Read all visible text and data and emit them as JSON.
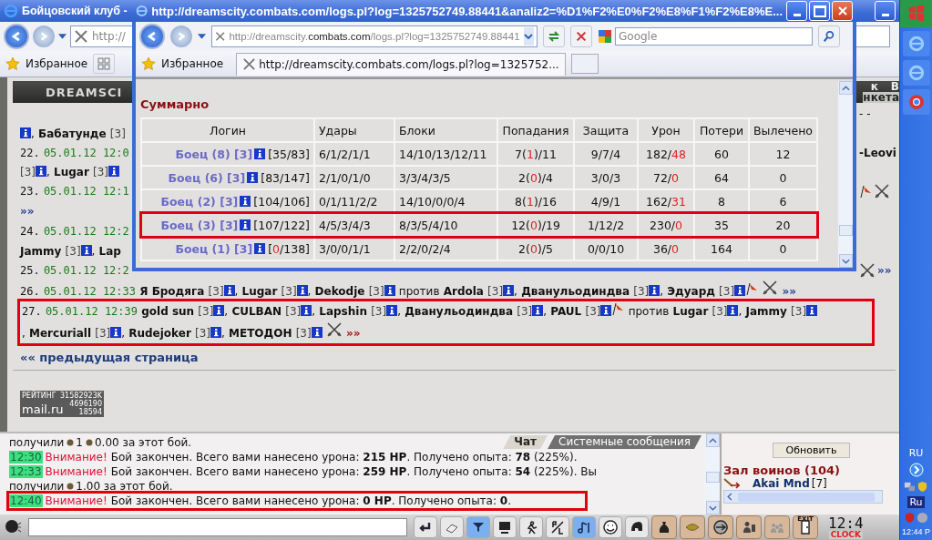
{
  "back_window": {
    "title": "Бойцовский клуб -",
    "address": "http://",
    "favorites": "Избранное",
    "logo": "DREAMSCI",
    "menu_top": [
      "к",
      "В"
    ],
    "menu_bottom": "нкета"
  },
  "log_lines": [
    {
      "right": [
        {
          "kind": "word",
          "text": "- -"
        }
      ]
    },
    {
      "left": [
        {
          "kind": "info"
        },
        {
          "kind": "sep",
          "text": ","
        },
        {
          "kind": "nick",
          "text": "Бабатунде"
        },
        {
          "kind": "lvl",
          "text": "[3]"
        }
      ]
    },
    {
      "left": [
        {
          "kind": "index",
          "text": "22."
        },
        {
          "kind": "time",
          "text": "05.01.12 12:0"
        }
      ],
      "right": [
        {
          "kind": "nick",
          "text": "-Leovi"
        }
      ]
    },
    {
      "left": [
        {
          "kind": "lvl",
          "text": "[3]"
        },
        {
          "kind": "info"
        },
        {
          "kind": "sep",
          "text": ","
        },
        {
          "kind": "nick",
          "text": "Lugar"
        },
        {
          "kind": "lvl",
          "text": "[3]"
        },
        {
          "kind": "info"
        }
      ]
    },
    {
      "left": [
        {
          "kind": "index",
          "text": "23."
        },
        {
          "kind": "time",
          "text": "05.01.12 12:1"
        }
      ],
      "right": [
        {
          "kind": "flag"
        },
        {
          "kind": "swords"
        }
      ]
    },
    {
      "left": [
        {
          "kind": "more",
          "text": "»»",
          "color": "#28449a"
        }
      ]
    },
    {
      "left": [
        {
          "kind": "index",
          "text": "24."
        },
        {
          "kind": "time",
          "text": "05.01.12 12:2"
        }
      ]
    },
    {
      "left": [
        {
          "kind": "nick",
          "text": "Jammy"
        },
        {
          "kind": "lvl",
          "text": "[3]"
        },
        {
          "kind": "info"
        },
        {
          "kind": "sep",
          "text": ","
        },
        {
          "kind": "nick",
          "text": "Lap"
        }
      ]
    },
    {
      "left": [
        {
          "kind": "index",
          "text": "25."
        },
        {
          "kind": "time",
          "text": "05.01.12 12:2"
        }
      ],
      "right": [
        {
          "kind": "swords"
        },
        {
          "kind": "more",
          "text": "»»",
          "color": "#28449a"
        }
      ]
    },
    {
      "left": [
        {
          "kind": "index",
          "text": "26."
        },
        {
          "kind": "time",
          "text": "05.01.12 12:33"
        },
        {
          "kind": "nick",
          "text": "Я Бродяга"
        },
        {
          "kind": "lvl",
          "text": "[3]"
        },
        {
          "kind": "info"
        },
        {
          "kind": "sep",
          "text": ","
        },
        {
          "kind": "nick",
          "text": "Lugar"
        },
        {
          "kind": "lvl",
          "text": "[3]"
        },
        {
          "kind": "info"
        },
        {
          "kind": "sep",
          "text": ","
        },
        {
          "kind": "nick",
          "text": "Dekodje"
        },
        {
          "kind": "lvl",
          "text": "[3]"
        },
        {
          "kind": "info"
        },
        {
          "kind": "word",
          "text": "против"
        },
        {
          "kind": "nick",
          "text": "Ardola"
        },
        {
          "kind": "lvl",
          "text": "[3]"
        },
        {
          "kind": "info"
        },
        {
          "kind": "sep",
          "text": ","
        },
        {
          "kind": "nick",
          "text": "Дванульодиндва"
        },
        {
          "kind": "lvl",
          "text": "[3]"
        },
        {
          "kind": "info"
        },
        {
          "kind": "sep",
          "text": ","
        },
        {
          "kind": "nick",
          "text": "Эдуард"
        },
        {
          "kind": "lvl",
          "text": "[3]"
        },
        {
          "kind": "info"
        },
        {
          "kind": "flag"
        },
        {
          "kind": "swords"
        },
        {
          "kind": "more",
          "text": "»»",
          "color": "#28449a"
        }
      ],
      "highlighted": false
    },
    {
      "left": [
        {
          "kind": "index",
          "text": "27."
        },
        {
          "kind": "time",
          "text": "05.01.12 12:39"
        },
        {
          "kind": "nick",
          "text": "gold sun"
        },
        {
          "kind": "lvl",
          "text": "[3]"
        },
        {
          "kind": "info"
        },
        {
          "kind": "sep",
          "text": ","
        },
        {
          "kind": "nick",
          "text": "CULBAN"
        },
        {
          "kind": "lvl",
          "text": "[3]"
        },
        {
          "kind": "info"
        },
        {
          "kind": "sep",
          "text": ","
        },
        {
          "kind": "nick",
          "text": "Lapshin"
        },
        {
          "kind": "lvl",
          "text": "[3]"
        },
        {
          "kind": "info"
        },
        {
          "kind": "sep",
          "text": ","
        },
        {
          "kind": "nick",
          "text": "Дванульодиндва"
        },
        {
          "kind": "lvl",
          "text": "[3]"
        },
        {
          "kind": "info"
        },
        {
          "kind": "sep",
          "text": ","
        },
        {
          "kind": "nick",
          "text": "PAUL"
        },
        {
          "kind": "lvl",
          "text": "[3]"
        },
        {
          "kind": "info"
        },
        {
          "kind": "flag"
        },
        {
          "kind": "word",
          "text": "против"
        },
        {
          "kind": "nick",
          "text": "Lugar"
        },
        {
          "kind": "lvl",
          "text": "[3]"
        },
        {
          "kind": "info"
        },
        {
          "kind": "sep",
          "text": ","
        },
        {
          "kind": "nick",
          "text": "Jammy"
        },
        {
          "kind": "lvl",
          "text": "[3]"
        },
        {
          "kind": "info"
        },
        {
          "kind": "sep",
          "text": ","
        },
        {
          "kind": "nick",
          "text": "Mercuriall"
        },
        {
          "kind": "lvl",
          "text": "[3]"
        },
        {
          "kind": "info"
        },
        {
          "kind": "sep",
          "text": ","
        },
        {
          "kind": "nick",
          "text": "Rudejoker"
        },
        {
          "kind": "lvl",
          "text": "[3]"
        },
        {
          "kind": "info"
        },
        {
          "kind": "sep",
          "text": ","
        },
        {
          "kind": "nick",
          "text": "МЕТОДОН"
        },
        {
          "kind": "lvl",
          "text": "[3]"
        },
        {
          "kind": "info"
        },
        {
          "kind": "swords"
        },
        {
          "kind": "more",
          "text": "»»",
          "color": "#a01818"
        }
      ],
      "highlighted": true
    }
  ],
  "prev_page": "«« предыдущая страница",
  "counter": {
    "label": "РЕЙТИНГ",
    "total": "31582923K",
    "logo": "mail.ru",
    "hits": "4696190",
    "hosts": "18594"
  },
  "popup": {
    "title": "http://dreamscity.combats.com/logs.pl?log=1325752749.88441&analiz2=%D1%F2%E0%F2%E8%F1%F2%E8%E...",
    "address": [
      "http://dreamscity.",
      "combats.com",
      "/logs.pl?log=1325752749.88441"
    ],
    "search_placeholder": "Google",
    "favorites": "Избранное",
    "tab": "http://dreamscity.combats.com/logs.pl?log=1325752...",
    "heading": "Суммарно",
    "columns": [
      "Логин",
      "Удары",
      "Блоки",
      "Попадания",
      "Защита",
      "Урон",
      "Потери",
      "Вылечено"
    ],
    "rows": [
      {
        "name": "Боец (8)",
        "level": "[3]",
        "hp": [
          "[",
          "35",
          "/83]"
        ],
        "dead": false,
        "strikes": "6/1/2/1/1",
        "blocks": "14/10/13/12/11",
        "hits": [
          "7(",
          "1",
          ")/11"
        ],
        "defense": "9/7/4",
        "damage": [
          "182/",
          "48"
        ],
        "losses": "60",
        "healed": "12",
        "highlighted": false
      },
      {
        "name": "Боец (6)",
        "level": "[3]",
        "hp": [
          "[",
          "83",
          "/147]"
        ],
        "dead": false,
        "strikes": "2/1/0/1/0",
        "blocks": "3/3/4/3/5",
        "hits": [
          "2(",
          "0",
          ")/4"
        ],
        "defense": "3/0/3",
        "damage": [
          "72/",
          "0"
        ],
        "losses": "64",
        "healed": "0",
        "highlighted": false
      },
      {
        "name": "Боец (2)",
        "level": "[3]",
        "hp": [
          "[",
          "104",
          "/106]"
        ],
        "dead": false,
        "strikes": "0/1/11/2/2",
        "blocks": "14/10/0/0/4",
        "hits": [
          "8(",
          "1",
          ")/16"
        ],
        "defense": "4/9/1",
        "damage": [
          "162/",
          "31"
        ],
        "losses": "8",
        "healed": "6",
        "highlighted": false
      },
      {
        "name": "Боец (3)",
        "level": "[3]",
        "hp": [
          "[",
          "107",
          "/122]"
        ],
        "dead": false,
        "strikes": "4/5/3/4/3",
        "blocks": "8/3/5/4/10",
        "hits": [
          "12(",
          "0",
          ")/19"
        ],
        "defense": "1/12/2",
        "damage": [
          "230/",
          "0"
        ],
        "losses": "35",
        "healed": "20",
        "highlighted": true
      },
      {
        "name": "Боец (1)",
        "level": "[3]",
        "hp": [
          "[",
          "0",
          "/138]"
        ],
        "dead": true,
        "strikes": "3/0/0/1/1",
        "blocks": "2/2/0/2/4",
        "hits": [
          "2(",
          "0",
          ")/5"
        ],
        "defense": "0/0/10",
        "damage": [
          "36/",
          "0"
        ],
        "losses": "164",
        "healed": "0",
        "highlighted": false
      }
    ]
  },
  "chat": {
    "tabs": [
      {
        "label": "Чат",
        "selected": true
      },
      {
        "label": "Системные сообщения",
        "selected": false
      }
    ],
    "lines": [
      {
        "kind": "reward",
        "segments": [
          {
            "kind": "text",
            "text": "получили"
          },
          {
            "kind": "coin"
          },
          {
            "kind": "text",
            "text": "1"
          },
          {
            "kind": "coin"
          },
          {
            "kind": "text",
            "text": "0.00 за этот бой."
          }
        ],
        "highlighted": false
      },
      {
        "kind": "alert",
        "time": "12:30",
        "label": "Внимание!",
        "text": "Бой закончен. Всего вами нанесено урона: **215 HP**. Получено опыта: **78** (225%).",
        "highlighted": false
      },
      {
        "kind": "alert",
        "time": "12:33",
        "label": "Внимание!",
        "text": "Бой закончен. Всего вами нанесено урона: **259 HP**. Получено опыта: **54** (225%). Вы",
        "highlighted": false
      },
      {
        "kind": "reward",
        "segments": [
          {
            "kind": "text",
            "text": "получили"
          },
          {
            "kind": "coin"
          },
          {
            "kind": "text",
            "text": "1.00 за этот бой."
          }
        ],
        "highlighted": false
      },
      {
        "kind": "alert",
        "time": "12:40",
        "label": "Внимание!",
        "text": "Бой закончен. Всего вами нанесено урона: **0 HP**. Получено опыта: **0**.",
        "highlighted": true
      }
    ]
  },
  "side_panel": {
    "refresh": "Обновить",
    "room": "Зал воинов (104)",
    "user": "Akai Mnd",
    "user_level": "[7]"
  },
  "toolbar": [
    {
      "kind": "eraser",
      "on": false
    },
    {
      "kind": "filter",
      "on": true
    },
    {
      "kind": "alert",
      "on": false
    },
    {
      "kind": "runner",
      "on": false
    },
    {
      "kind": "pl",
      "on": false
    },
    {
      "kind": "music",
      "on": true
    },
    {
      "kind": "smile",
      "on": false
    },
    {
      "kind": "helmet",
      "on": false
    }
  ],
  "actions": [
    {
      "kind": "bag"
    },
    {
      "kind": "gold"
    },
    {
      "kind": "trade"
    },
    {
      "kind": "person"
    },
    {
      "kind": "group"
    },
    {
      "kind": "exit",
      "text": "EXIT"
    }
  ],
  "clock": {
    "time": "12:4",
    "label": "CLOCK"
  },
  "taskbar": {
    "lang": "RU",
    "input_lang": "Ru",
    "time": "12:44 P"
  }
}
